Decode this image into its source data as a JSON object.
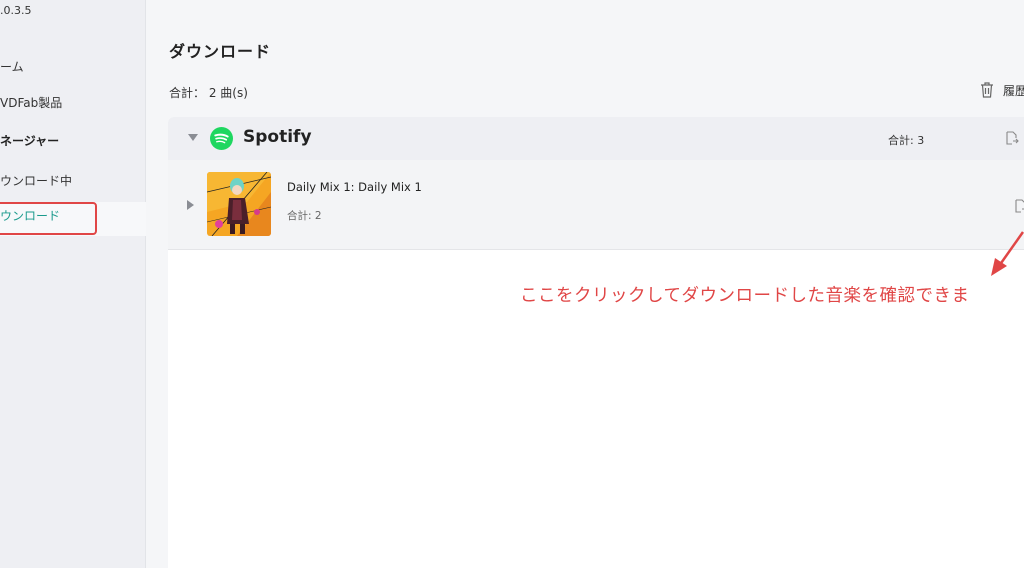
{
  "sidebar": {
    "version": ".0.3.5",
    "items": [
      {
        "label": "ーム"
      },
      {
        "label": "VDFab製品"
      },
      {
        "label": "ネージャー"
      },
      {
        "label": "ウンロード中"
      },
      {
        "label": "ウンロード"
      }
    ]
  },
  "main": {
    "title": "ダウンロード",
    "total_label": "合計：",
    "total_value": "2 曲(s)",
    "history_label": "履歴"
  },
  "group": {
    "name": "Spotify",
    "count": "合計: 3"
  },
  "items": [
    {
      "title": "Daily Mix 1: Daily Mix 1",
      "count": "合計: 2"
    }
  ],
  "annotation": {
    "text": "ここをクリックしてダウンロードした音楽を確認できま"
  },
  "colors": {
    "accent": "#1a9a8c",
    "annotation": "#e04646",
    "spotify": "#1ed760"
  }
}
